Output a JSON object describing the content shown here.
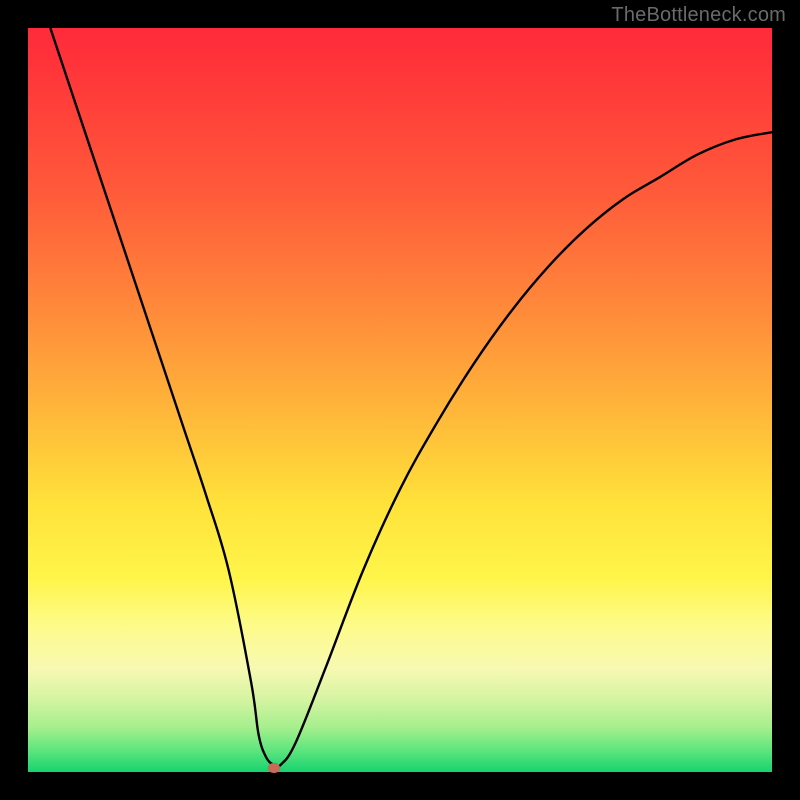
{
  "watermark": "TheBottleneck.com",
  "chart_data": {
    "type": "line",
    "title": "",
    "xlabel": "",
    "ylabel": "",
    "xlim": [
      0,
      100
    ],
    "ylim": [
      0,
      100
    ],
    "grid": false,
    "legend": false,
    "series": [
      {
        "name": "bottleneck-curve",
        "x": [
          3,
          6,
          9,
          12,
          15,
          18,
          21,
          24,
          27,
          30,
          31,
          32,
          33,
          34,
          36,
          40,
          45,
          50,
          55,
          60,
          65,
          70,
          75,
          80,
          85,
          90,
          95,
          100
        ],
        "y": [
          100,
          91,
          82,
          73,
          64,
          55,
          46,
          37,
          27,
          12,
          5,
          2,
          1,
          1,
          4,
          14,
          27,
          38,
          47,
          55,
          62,
          68,
          73,
          77,
          80,
          83,
          85,
          86
        ]
      }
    ],
    "marker": {
      "x": 33,
      "y": 0.5,
      "color": "#c96b5a"
    },
    "colors": {
      "background_top": "#ff2a3a",
      "background_bottom": "#17d36e",
      "curve": "#000000",
      "frame": "#000000"
    }
  }
}
